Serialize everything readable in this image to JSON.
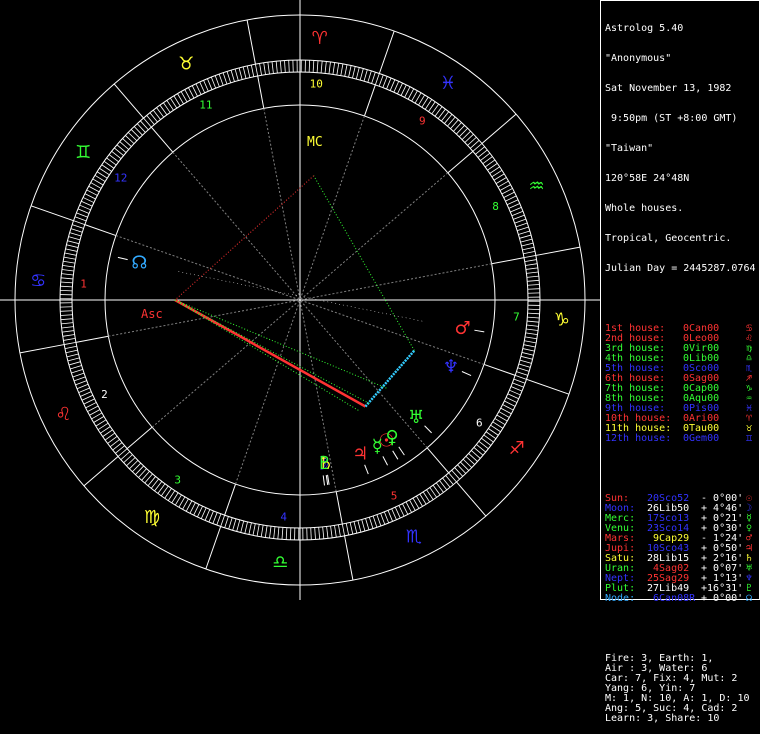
{
  "header": {
    "program": "Astrolog 5.40",
    "name": "\"Anonymous\"",
    "date": "Sat November 13, 1982",
    "time": " 9:50pm (ST +8:00 GMT)",
    "place": "\"Taiwan\"",
    "coords": "120°58E 24°48N",
    "system": "Whole houses.",
    "zodiac": "Tropical, Geocentric.",
    "julian": "Julian Day = 2445287.0764"
  },
  "houses": [
    {
      "label": "1st house:",
      "cusp": "0Can00",
      "glyph": "♋",
      "color": "#ff3333"
    },
    {
      "label": "2nd house:",
      "cusp": "0Leo00",
      "glyph": "♌",
      "color": "#ff3333"
    },
    {
      "label": "3rd house:",
      "cusp": "0Vir00",
      "glyph": "♍",
      "color": "#33ff33"
    },
    {
      "label": "4th house:",
      "cusp": "0Lib00",
      "glyph": "♎",
      "color": "#33ff33"
    },
    {
      "label": "5th house:",
      "cusp": "0Sco00",
      "glyph": "♏",
      "color": "#3333ff"
    },
    {
      "label": "6th house:",
      "cusp": "0Sag00",
      "glyph": "♐",
      "color": "#ff3333"
    },
    {
      "label": "7th house:",
      "cusp": "0Cap00",
      "glyph": "♑",
      "color": "#33ff33"
    },
    {
      "label": "8th house:",
      "cusp": "0Aqu00",
      "glyph": "♒",
      "color": "#33ff33"
    },
    {
      "label": "9th house:",
      "cusp": "0Pis00",
      "glyph": "♓",
      "color": "#3333ff"
    },
    {
      "label": "10th house:",
      "cusp": "0Ari00",
      "glyph": "♈",
      "color": "#ff3333"
    },
    {
      "label": "11th house:",
      "cusp": "0Tau00",
      "glyph": "♉",
      "color": "#ffff33"
    },
    {
      "label": "12th house:",
      "cusp": "0Gem00",
      "glyph": "♊",
      "color": "#3333ff"
    }
  ],
  "planets": [
    {
      "name": "Sun:",
      "pos": "20Sco52",
      "motion": " - 0°00'",
      "glyph": "☉",
      "color": "#ff3333",
      "poscolor": "#3333ff"
    },
    {
      "name": "Moon:",
      "pos": "26Lib50",
      "motion": " + 4°46'",
      "glyph": "☽",
      "color": "#3333ff",
      "poscolor": "#ffffff"
    },
    {
      "name": "Merc:",
      "pos": "17Sco13",
      "motion": " + 0°21'",
      "glyph": "☿",
      "color": "#33ff33",
      "poscolor": "#3333ff"
    },
    {
      "name": "Venu:",
      "pos": "23Sco14",
      "motion": " + 0°30'",
      "glyph": "♀",
      "color": "#33ff33",
      "poscolor": "#3333ff"
    },
    {
      "name": "Mars:",
      "pos": " 9Cap29",
      "motion": " - 1°24'",
      "glyph": "♂",
      "color": "#ff3333",
      "poscolor": "#ffff33"
    },
    {
      "name": "Jupi:",
      "pos": "10Sco43",
      "motion": " + 0°50'",
      "glyph": "♃",
      "color": "#ff3333",
      "poscolor": "#3333ff"
    },
    {
      "name": "Satu:",
      "pos": "28Lib15",
      "motion": " + 2°16'",
      "glyph": "♄",
      "color": "#ffff33",
      "poscolor": "#ffffff"
    },
    {
      "name": "Uran:",
      "pos": " 4Sag02",
      "motion": " + 0°07'",
      "glyph": "♅",
      "color": "#33ff33",
      "poscolor": "#ff3333"
    },
    {
      "name": "Nept:",
      "pos": "25Sag29",
      "motion": " + 1°13'",
      "glyph": "♆",
      "color": "#3333ff",
      "poscolor": "#ff3333"
    },
    {
      "name": "Plut:",
      "pos": "27Lib49",
      "motion": " +16°31'",
      "glyph": "♇",
      "color": "#33ff33",
      "poscolor": "#ffffff"
    },
    {
      "name": "Node:",
      "pos": " 6Can08R",
      "motion": " + 0°00'",
      "glyph": "☊",
      "color": "#33aaff",
      "poscolor": "#3333ff"
    }
  ],
  "stats": [
    "Fire: 3, Earth: 1,",
    "Air : 3, Water: 6",
    "Car: 7, Fix: 4, Mut: 2",
    "Yang: 6, Yin: 7",
    "M: 1, N: 10, A: 1, D: 10",
    "Ang: 5, Suc: 4, Cad: 2",
    "Learn: 3, Share: 10"
  ],
  "wheel": {
    "house_numbers": [
      "1",
      "2",
      "3",
      "4",
      "5",
      "6",
      "7",
      "8",
      "9",
      "10",
      "11",
      "12"
    ],
    "asc_label": "Asc",
    "mc_label": "MC",
    "signs": [
      {
        "glyph": "♈",
        "color": "#ff3333",
        "lon": 0
      },
      {
        "glyph": "♉",
        "color": "#ffff33",
        "lon": 30
      },
      {
        "glyph": "♊",
        "color": "#33ff33",
        "lon": 60
      },
      {
        "glyph": "♋",
        "color": "#3333ff",
        "lon": 90
      },
      {
        "glyph": "♌",
        "color": "#ff3333",
        "lon": 120
      },
      {
        "glyph": "♍",
        "color": "#ffff33",
        "lon": 150
      },
      {
        "glyph": "♎",
        "color": "#33ff33",
        "lon": 180
      },
      {
        "glyph": "♏",
        "color": "#3333ff",
        "lon": 210
      },
      {
        "glyph": "♐",
        "color": "#ff3333",
        "lon": 240
      },
      {
        "glyph": "♑",
        "color": "#ffff33",
        "lon": 270
      },
      {
        "glyph": "♒",
        "color": "#33ff33",
        "lon": 300
      },
      {
        "glyph": "♓",
        "color": "#3333ff",
        "lon": 330
      }
    ],
    "ascendant_lon": 109.3,
    "mc_lon": 13.0,
    "bodies": [
      {
        "glyph": "☉",
        "color": "#ff3333",
        "lon": 230.87
      },
      {
        "glyph": "☽",
        "color": "#3333ff",
        "lon": 206.83
      },
      {
        "glyph": "☿",
        "color": "#33ff33",
        "lon": 227.22
      },
      {
        "glyph": "♀",
        "color": "#33ff33",
        "lon": 233.23
      },
      {
        "glyph": "♂",
        "color": "#ff3333",
        "lon": 279.48
      },
      {
        "glyph": "♃",
        "color": "#ff3333",
        "lon": 220.72
      },
      {
        "glyph": "♄",
        "color": "#ffff33",
        "lon": 208.25
      },
      {
        "glyph": "♅",
        "color": "#33ff33",
        "lon": 244.03
      },
      {
        "glyph": "♆",
        "color": "#3333ff",
        "lon": 265.48
      },
      {
        "glyph": "♇",
        "color": "#33ff33",
        "lon": 207.82
      },
      {
        "glyph": "☊",
        "color": "#33aaff",
        "lon": 96.13
      }
    ]
  }
}
